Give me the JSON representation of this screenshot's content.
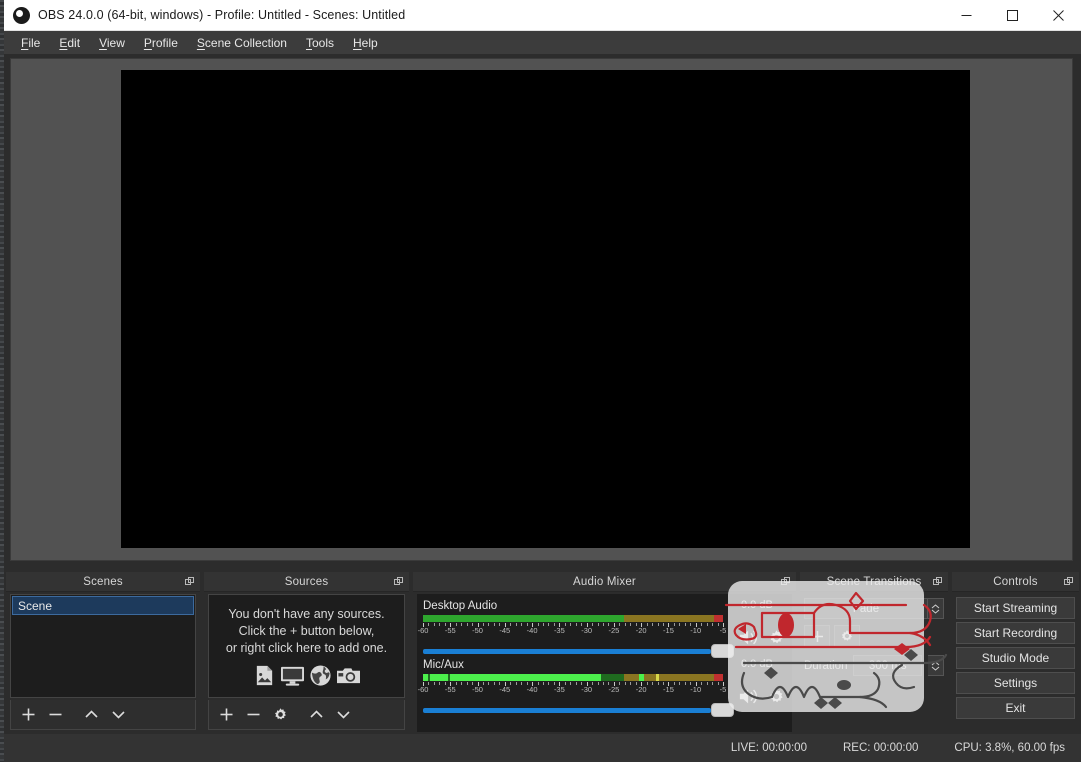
{
  "window": {
    "title": "OBS 24.0.0 (64-bit, windows) - Profile: Untitled - Scenes: Untitled",
    "logo_icon": "obs-logo-icon",
    "minimize_icon": "minimize-icon",
    "maximize_icon": "maximize-icon",
    "close_icon": "close-icon"
  },
  "menubar": {
    "items": [
      {
        "label": "File",
        "accel": "F",
        "rest": "ile"
      },
      {
        "label": "Edit",
        "accel": "E",
        "rest": "dit"
      },
      {
        "label": "View",
        "accel": "V",
        "rest": "iew"
      },
      {
        "label": "Profile",
        "accel": "P",
        "rest": "rofile"
      },
      {
        "label": "Scene Collection",
        "accel": "S",
        "rest": "cene Collection"
      },
      {
        "label": "Tools",
        "accel": "T",
        "rest": "ools"
      },
      {
        "label": "Help",
        "accel": "H",
        "rest": "elp"
      }
    ]
  },
  "preview": {
    "canvas_color": "#000000",
    "background_color": "#525252"
  },
  "scenes": {
    "title": "Scenes",
    "float_icon": "undock-icon",
    "items": [
      {
        "label": "Scene",
        "selected": true
      }
    ],
    "toolbar": {
      "add": "+",
      "remove": "−",
      "move_up": "∧",
      "move_down": "∨",
      "add_name": "add-scene-button",
      "remove_name": "remove-scene-button"
    }
  },
  "sources": {
    "title": "Sources",
    "float_icon": "undock-icon",
    "empty_lines": [
      "You don't have any sources.",
      "Click the + button below,",
      "or right click here to add one."
    ],
    "hint_icons": [
      "image-icon",
      "display-icon",
      "browser-globe-icon",
      "camera-icon"
    ],
    "toolbar": {
      "add": "+",
      "remove": "−",
      "properties": "gear-icon",
      "move_up": "∧",
      "move_down": "∨"
    }
  },
  "audio_mixer": {
    "title": "Audio Mixer",
    "float_icon": "undock-icon",
    "tick_labels": [
      "-60",
      "-55",
      "-50",
      "-45",
      "-40",
      "-35",
      "-30",
      "-25",
      "-20",
      "-15",
      "-10",
      "-5"
    ],
    "sources": [
      {
        "name": "Desktop Audio",
        "db": "0.0 dB",
        "volume_percent": 96,
        "meter": {
          "green_pct": 67,
          "olive_pct": 33,
          "peak_pct": 0,
          "active_pct": 0
        },
        "mute_icon": "speaker-icon",
        "settings_icon": "gear-icon"
      },
      {
        "name": "Mic/Aux",
        "db": "0.0 dB",
        "volume_percent": 96,
        "meter": {
          "green_pct": 67,
          "olive_pct": 33,
          "peak_pct": 72,
          "active_pct": 60
        },
        "mute_icon": "speaker-icon",
        "settings_icon": "gear-icon"
      }
    ]
  },
  "scene_transitions": {
    "title": "Scene Transitions",
    "float_icon": "undock-icon",
    "transition": "Fade",
    "add_icon": "+",
    "properties_icon": "gear-icon",
    "duration_label": "Duration",
    "duration_value": "300 ms"
  },
  "controls": {
    "title": "Controls",
    "float_icon": "undock-icon",
    "buttons": [
      "Start Streaming",
      "Start Recording",
      "Studio Mode",
      "Settings",
      "Exit"
    ]
  },
  "statusbar": {
    "live": "LIVE: 00:00:00",
    "rec": "REC: 00:00:00",
    "cpu": "CPU: 3.8%, 60.00 fps"
  },
  "watermark": {
    "description": "persian-calligraphy-logo-overlay",
    "top_color": "#c0272d",
    "bottom_color": "#4a4a4a",
    "panel_color": "#ececec"
  }
}
